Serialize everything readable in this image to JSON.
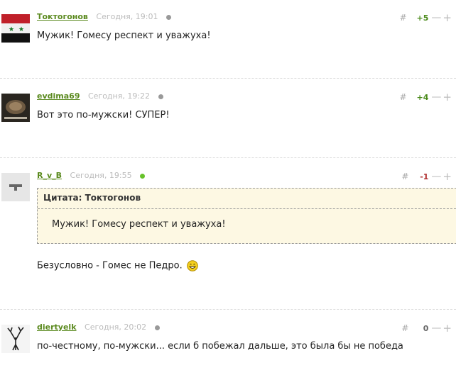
{
  "comments": [
    {
      "author": "Токтогонов",
      "time": "Сегодня, 19:01",
      "score": "+5",
      "text": "Мужик! Гомесу респект и уважуха!"
    },
    {
      "author": "evdima69",
      "time": "Сегодня, 19:22",
      "score": "+4",
      "text": "Вот это по-мужски! СУПЕР!"
    },
    {
      "author": "R_v_B",
      "time": "Сегодня, 19:55",
      "score": "-1",
      "quote_header": "Цитата: Токтогонов",
      "quote_text": "Мужик! Гомесу респект и уважуха!",
      "text": "Безусловно - Гомес не Педро."
    },
    {
      "author": "diertyelk",
      "time": "Сегодня, 20:02",
      "score": "0",
      "text": "по-честному, по-мужски... если б побежал дальше, это была бы не победа"
    }
  ],
  "controls": {
    "hash": "#",
    "minus": "—",
    "plus": "+"
  },
  "colors": {
    "author": "#5b8a1f",
    "positive": "#4a8a1a",
    "negative": "#b03030",
    "quote_bg": "#fdf8e3"
  }
}
